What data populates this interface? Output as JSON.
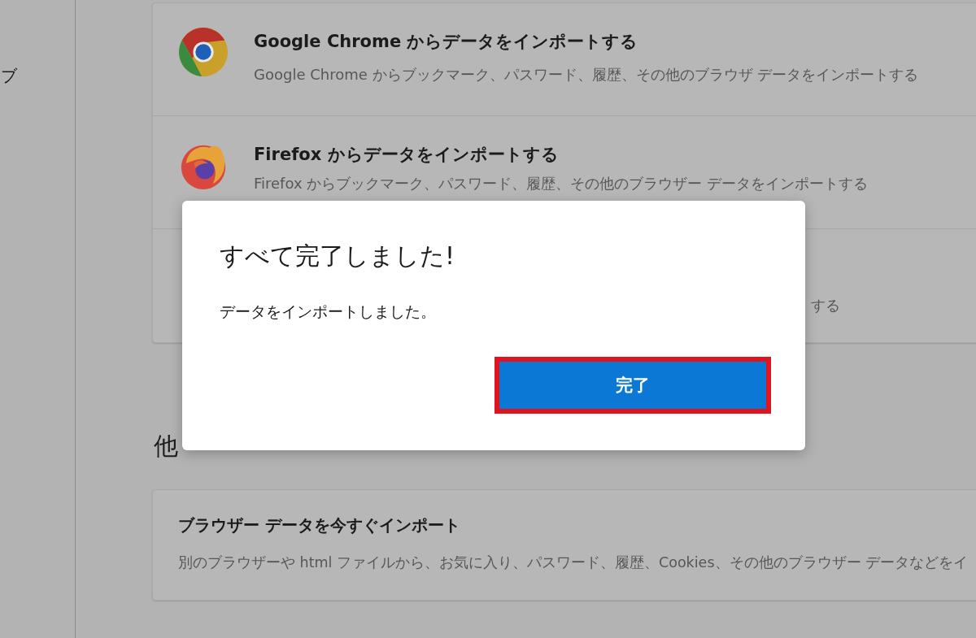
{
  "sidebar": {
    "items": [
      {
        "label": "ブ"
      }
    ]
  },
  "import_list": [
    {
      "kind": "chrome",
      "title": "Google Chrome からデータをインポートする",
      "description": "Google Chrome からブックマーク、パスワード、履歴、その他のブラウザ データをインポートする"
    },
    {
      "kind": "firefox",
      "title": "Firefox からデータをインポートする",
      "description": "Firefox からブックマーク、パスワード、履歴、その他のブラウザー データをインポートする"
    },
    {
      "kind": "other",
      "description": "する"
    }
  ],
  "section_heading": "他",
  "import_now_card": {
    "title": "ブラウザー データを今すぐインポート",
    "description": "別のブラウザーや html ファイルから、お気に入り、パスワード、履歴、Cookies、その他のブラウザー データなどをイ"
  },
  "dialog": {
    "title": "すべて完了しました!",
    "message": "データをインポートしました。",
    "button": {
      "label": "完了",
      "highlighted": true
    }
  }
}
